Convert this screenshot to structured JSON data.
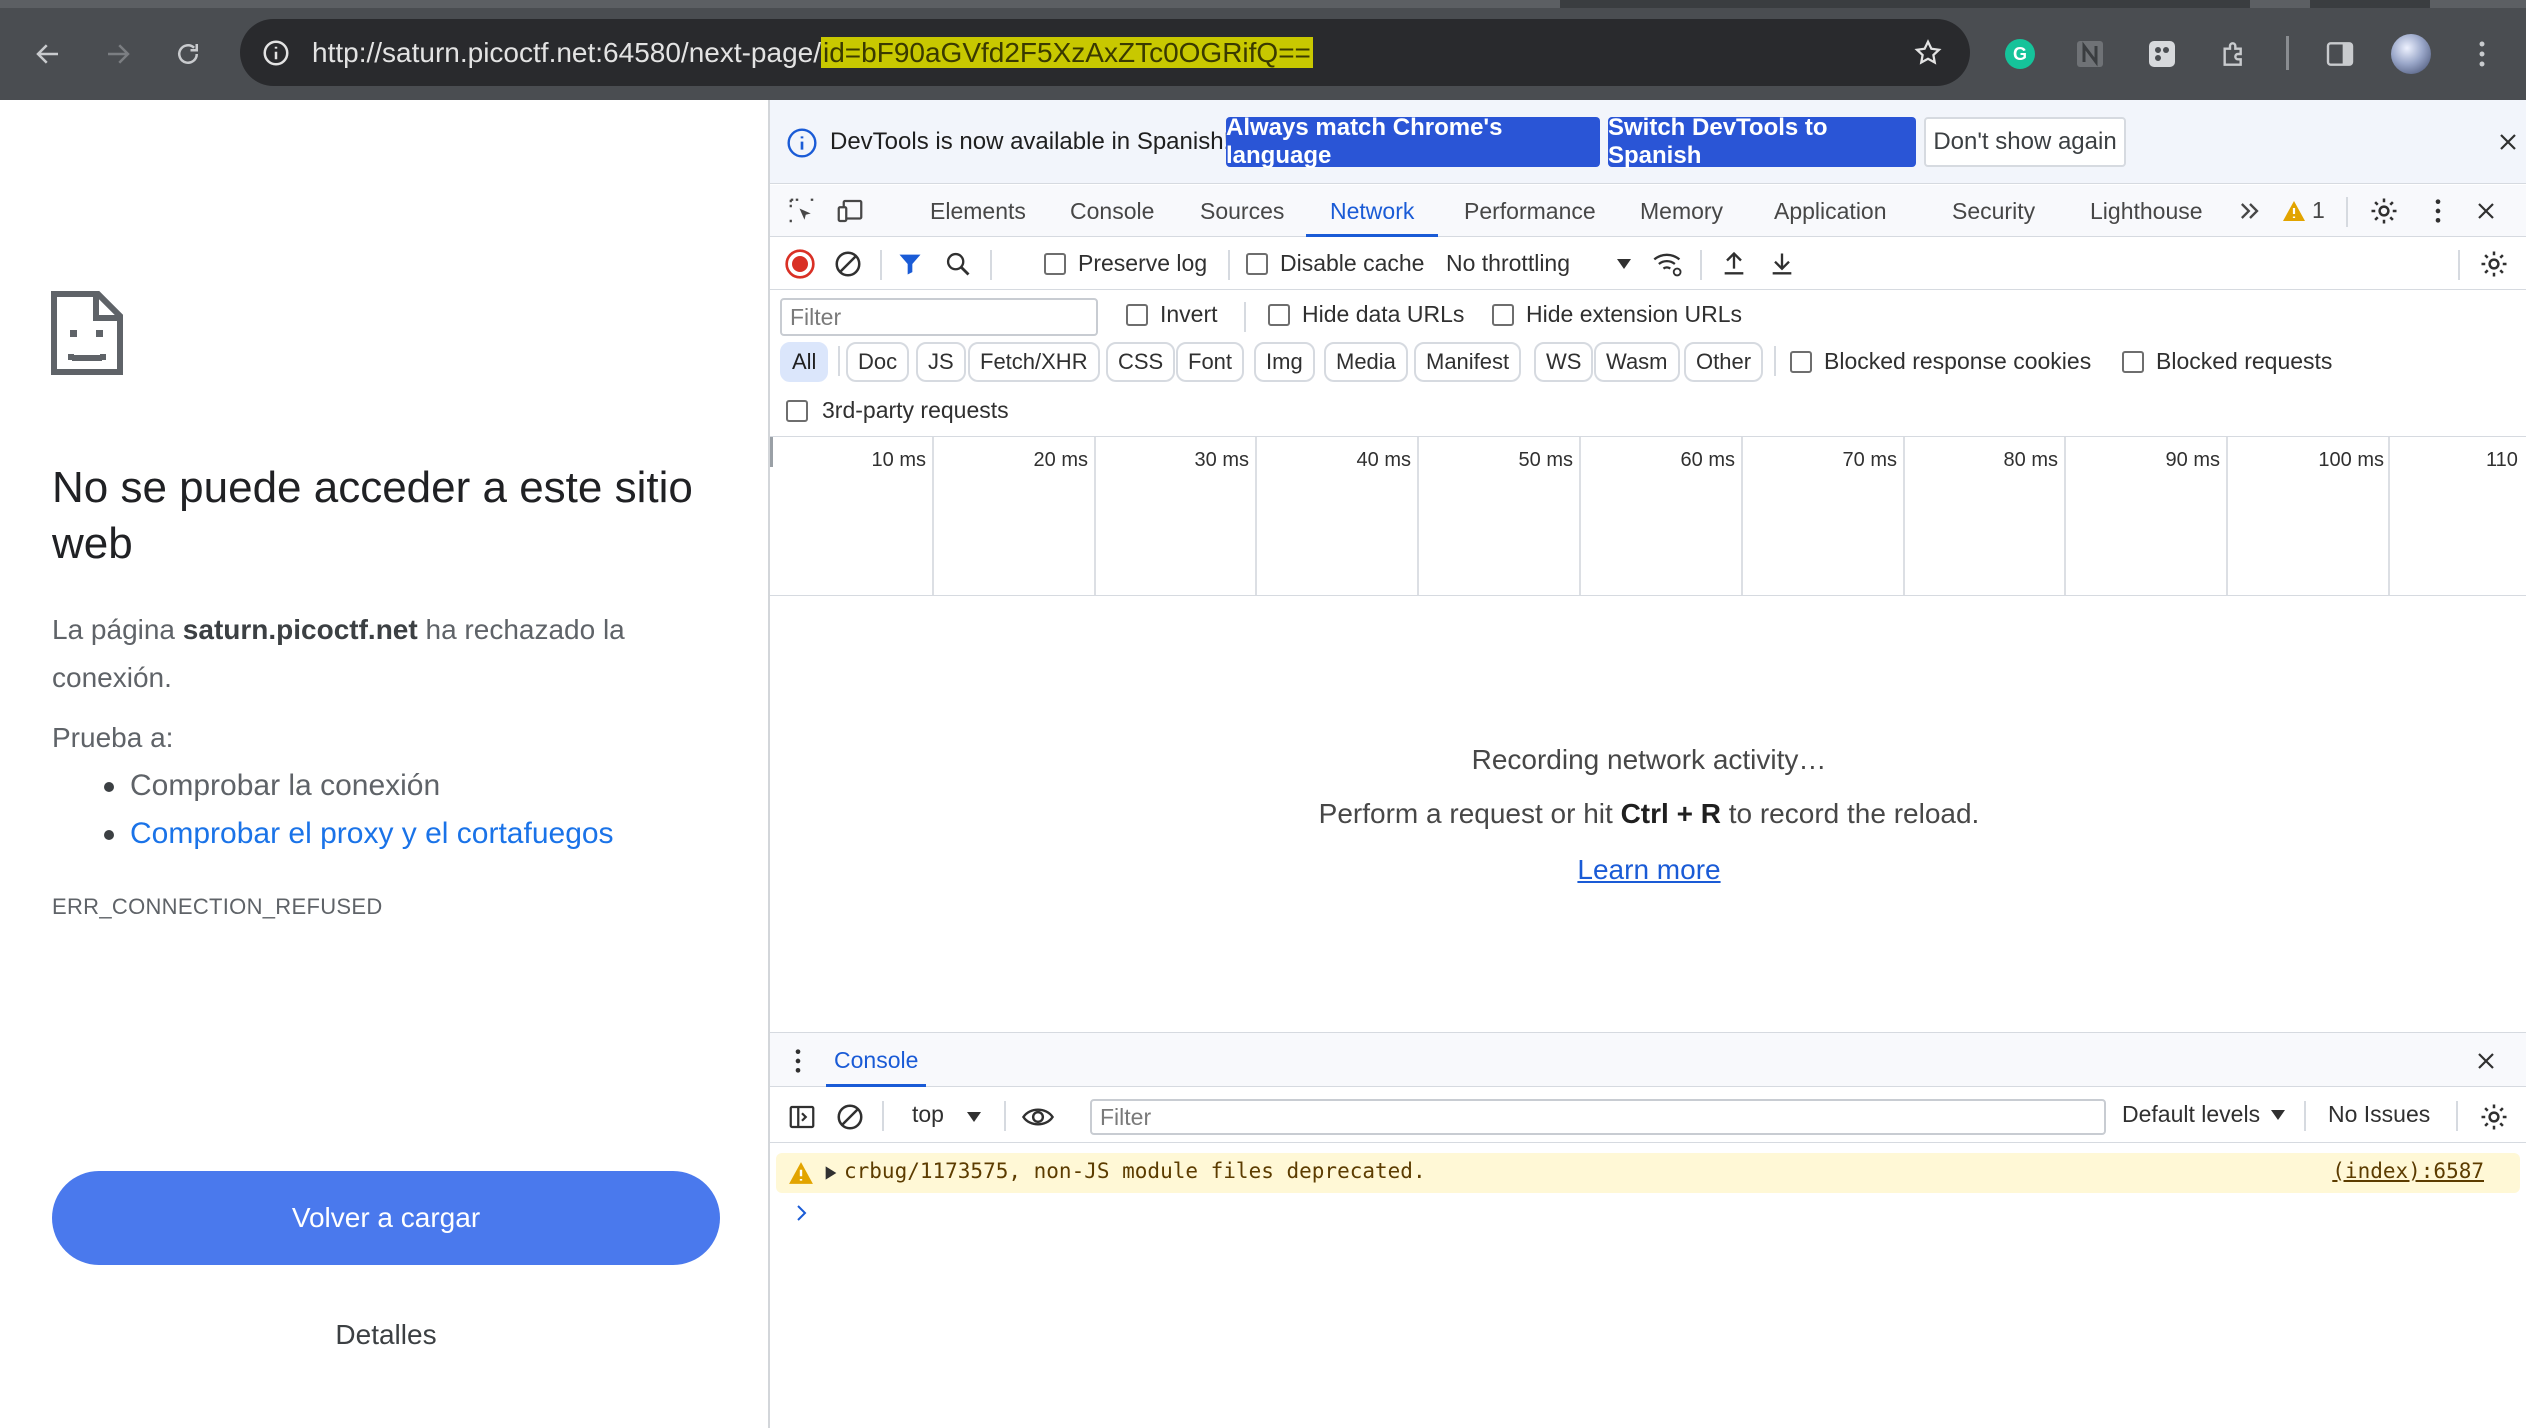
{
  "browser": {
    "url_base": "http://saturn.picoctf.net:64580/next-page/",
    "url_highlight": "id=bF90aGVfd2F5XzAxZTc0OGRifQ=="
  },
  "error_page": {
    "title": "No se puede acceder a este sitio web",
    "text_prefix": "La página ",
    "host": "saturn.picoctf.net",
    "text_suffix": " ha rechazado la conexión.",
    "try_label": "Prueba a:",
    "suggestions": [
      "Comprobar la conexión",
      "Comprobar el proxy y el cortafuegos"
    ],
    "error_code": "ERR_CONNECTION_REFUSED",
    "reload_label": "Volver a cargar",
    "details_label": "Detalles"
  },
  "devtools": {
    "infobar": {
      "message": "DevTools is now available in Spanish!",
      "btn_match": "Always match Chrome's language",
      "btn_switch": "Switch DevTools to Spanish",
      "btn_dismiss": "Don't show again"
    },
    "tabs": [
      "Elements",
      "Console",
      "Sources",
      "Network",
      "Performance",
      "Memory",
      "Application",
      "Security",
      "Lighthouse"
    ],
    "active_tab": "Network",
    "warning_count": "1",
    "network_toolbar": {
      "preserve_log": "Preserve log",
      "disable_cache": "Disable cache",
      "throttling": "No throttling"
    },
    "filter": {
      "placeholder": "Filter",
      "invert": "Invert",
      "hide_data_urls": "Hide data URLs",
      "hide_extension_urls": "Hide extension URLs",
      "types": [
        "All",
        "Doc",
        "JS",
        "Fetch/XHR",
        "CSS",
        "Font",
        "Img",
        "Media",
        "Manifest",
        "WS",
        "Wasm",
        "Other"
      ],
      "active_type": "All",
      "blocked_response_cookies": "Blocked response cookies",
      "blocked_requests": "Blocked requests",
      "third_party": "3rd-party requests"
    },
    "timeline_ticks": [
      "10 ms",
      "20 ms",
      "30 ms",
      "40 ms",
      "50 ms",
      "60 ms",
      "70 ms",
      "80 ms",
      "90 ms",
      "100 ms",
      "110"
    ],
    "empty": {
      "recording": "Recording network activity…",
      "hint_prefix": "Perform a request or hit ",
      "hint_keys": "Ctrl + R",
      "hint_suffix": " to record the reload.",
      "learn_more": "Learn more"
    },
    "drawer": {
      "tab": "Console",
      "context": "top",
      "filter_placeholder": "Filter",
      "levels": "Default levels",
      "issues": "No Issues",
      "warning_message": "crbug/1173575, non-JS module files deprecated.",
      "warning_source": "(index):6587"
    }
  },
  "colors": {
    "accent": "#1a5bd6",
    "reload_button": "#4a79ed",
    "url_highlight": "#c8c800",
    "warning_bg": "#fff8d6"
  }
}
